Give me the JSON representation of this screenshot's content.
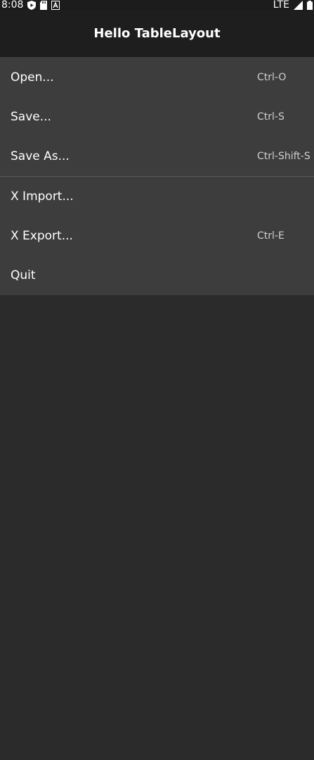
{
  "status_bar": {
    "time": "8:08",
    "network": "LTE",
    "icons": [
      "play-shield-icon",
      "sd-card-icon",
      "font-a-icon",
      "signal-icon",
      "battery-icon"
    ]
  },
  "app_bar": {
    "title": "Hello TableLayout"
  },
  "menu": {
    "groups": [
      [
        {
          "label": "Open...",
          "shortcut": "Ctrl-O"
        },
        {
          "label": "Save...",
          "shortcut": "Ctrl-S"
        },
        {
          "label": "Save As...",
          "shortcut": "Ctrl-Shift-S"
        }
      ],
      [
        {
          "label": "X Import...",
          "shortcut": ""
        },
        {
          "label": "X Export...",
          "shortcut": "Ctrl-E"
        },
        {
          "label": "Quit",
          "shortcut": ""
        }
      ]
    ]
  },
  "colors": {
    "status_bar_bg": "#1c1c1c",
    "app_bar_bg": "#1e1e1e",
    "menu_bg": "#3d3d3d",
    "page_bg": "#2b2b2b",
    "divider": "#5a5a5a"
  }
}
